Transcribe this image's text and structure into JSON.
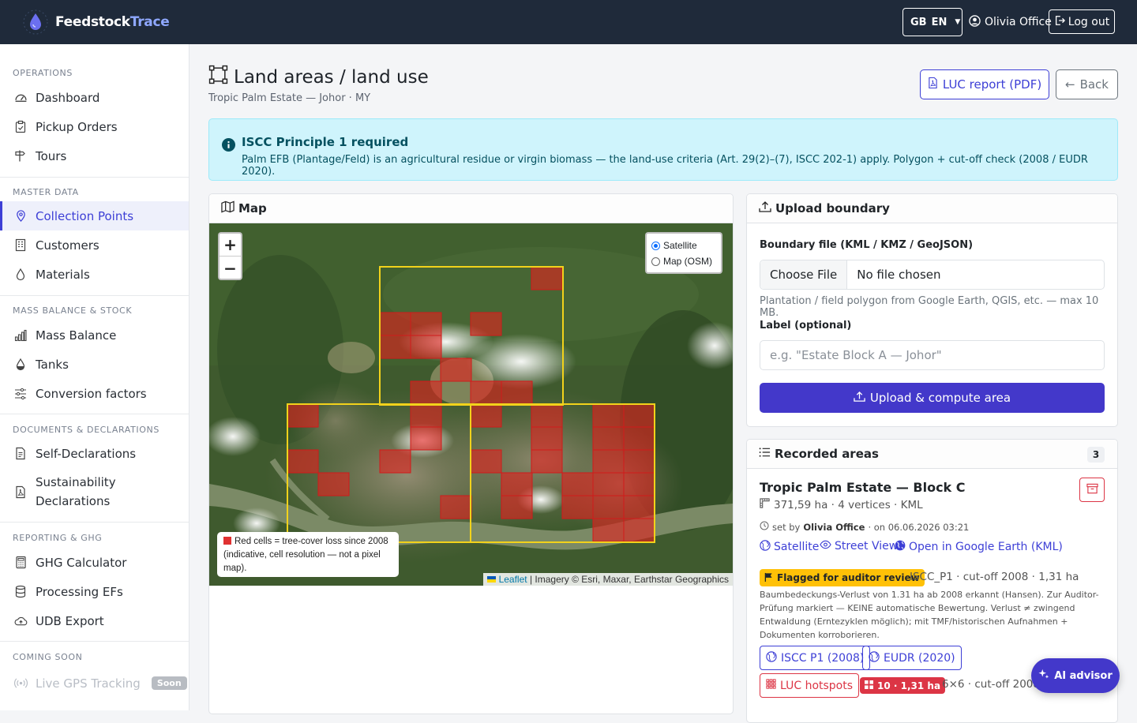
{
  "header": {
    "brand_a": "Feedstock",
    "brand_b": "Trace",
    "lang_flag": "GB",
    "lang_code": "EN",
    "user_name": "Olivia Office",
    "logout_label": "Log out"
  },
  "sidebar": {
    "sections": {
      "operations": "OPERATIONS",
      "master": "MASTER DATA",
      "mass": "MASS BALANCE & STOCK",
      "docs": "DOCUMENTS & DECLARATIONS",
      "reporting": "REPORTING & GHG",
      "soon": "COMING SOON"
    },
    "items": {
      "dashboard": "Dashboard",
      "pickup": "Pickup Orders",
      "tours": "Tours",
      "collection": "Collection Points",
      "customers": "Customers",
      "materials": "Materials",
      "massbalance": "Mass Balance",
      "tanks": "Tanks",
      "conversion": "Conversion factors",
      "selfdecl": "Self-Declarations",
      "sust1": "Sustainability",
      "sust2": "Declarations",
      "ghg": "GHG Calculator",
      "processing": "Processing EFs",
      "udb": "UDB Export",
      "gps": "Live GPS Tracking",
      "soon_badge": "Soon"
    }
  },
  "page": {
    "title": "Land areas / land use",
    "subtitle": "Tropic Palm Estate — Johor · MY",
    "luc_report": "LUC report (PDF)",
    "back": "Back"
  },
  "alert": {
    "title": "ISCC Principle 1 required",
    "body": "Palm EFB (Plantage/Feld) is an agricultural residue or virgin biomass — the land-use criteria (Art. 29(2)–(7), ISCC 202-1) apply. Polygon + cut-off check (2008 / EUDR 2020)."
  },
  "map": {
    "title": "Map",
    "zoom_in": "+",
    "zoom_out": "−",
    "layer_satellite": "Satellite",
    "layer_osm": "Map (OSM)",
    "legend": "Red cells = tree-cover loss since 2008 (indicative, cell resolution — not a pixel map).",
    "attr_leaflet": "Leaflet",
    "attr_rest": "| Imagery © Esri, Maxar, Earthstar Geographics"
  },
  "upload": {
    "title": "Upload boundary",
    "file_label": "Boundary file (KML / KMZ / GeoJSON)",
    "choose": "Choose File",
    "no_file": "No file chosen",
    "help": "Plantation / field polygon from Google Earth, QGIS, etc. — max 10 MB.",
    "label_label": "Label (optional)",
    "label_placeholder": "e.g. \"Estate Block A — Johor\"",
    "submit": "Upload & compute area"
  },
  "recorded": {
    "title": "Recorded areas",
    "count": "3",
    "item": {
      "name": "Tropic Palm Estate — Block C",
      "stats": "371,59 ha · 4 vertices · KML",
      "set_by_prefix": "set by",
      "set_by_user": "Olivia Office",
      "set_on": "· on 06.06.2026 03:21",
      "link_satellite": "Satellite",
      "link_street": "Street View",
      "link_gearth": "Open in Google Earth (KML)",
      "flag": "Flagged for auditor review",
      "flag_meta": "ISCC_P1 · cut-off 2008 · 1,31 ha",
      "note": "Baumbedeckungs-Verlust von 1.31 ha ab 2008 erkannt (Hansen). Zur Auditor-Prüfung markiert — KEINE automatische Bewertung. Verlust ≠ zwingend Entwaldung (Erntezyklen möglich); mit TMF/historischen Aufnahmen + Dokumenten korroborieren.",
      "chip_iscc": "ISCC P1 (2008)",
      "chip_eudr": "EUDR (2020)",
      "chip_luc": "LUC hotspots",
      "hot_badge": "10 · 1,31 ha",
      "grid_meta": "6×6 · cut-off 2008"
    }
  },
  "ai": {
    "label": "AI advisor"
  },
  "colors": {
    "accent": "#4338ca",
    "topbar": "#1f2a3a",
    "danger": "#dc3545",
    "warning": "#ffc107"
  }
}
